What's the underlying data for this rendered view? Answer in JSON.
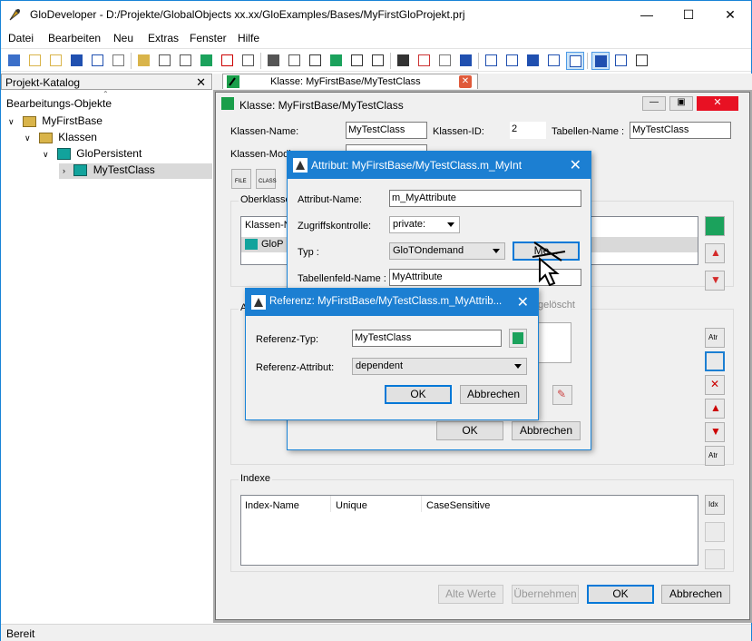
{
  "app": {
    "title": "GloDeveloper - D:/Projekte/GlobalObjects xx.xx/GloExamples/Bases/MyFirstGloProjekt.prj",
    "accent": "#1c7fd2"
  },
  "menu": [
    "Datei",
    "Bearbeiten",
    "Neu",
    "Extras",
    "Fenster",
    "Hilfe"
  ],
  "toolbar": {
    "icons": [
      "new-icon",
      "open-icon",
      "open-folder-icon",
      "save-icon",
      "save-all-icon",
      "properties-icon",
      "folder-icon",
      "new-file-icon",
      "new-class-icon",
      "edit-icon",
      "delete-icon",
      "cut-icon",
      "copy-icon",
      "paste-icon",
      "attribute-icon",
      "refresh-icon",
      "new-attribute-icon",
      "new-index-icon",
      "globe-icon",
      "grid-icon",
      "tools-icon",
      "window-icon",
      "cascade-icon",
      "tile-icon",
      "restore-icon",
      "maximize-icon",
      "layout-icon",
      "split-icon",
      "panel-icon",
      "book-icon"
    ]
  },
  "left_panel": {
    "header": "Projekt-Katalog",
    "section": "Bearbeitungs-Objekte",
    "tree": [
      {
        "label": "MyFirstBase",
        "level": 0
      },
      {
        "label": "Klassen",
        "level": 1
      },
      {
        "label": "GloPersistent",
        "level": 2
      },
      {
        "label": "MyTestClass",
        "level": 3,
        "selected": true
      }
    ]
  },
  "tab": {
    "label": "Klasse: MyFirstBase/MyTestClass"
  },
  "class_window": {
    "title": "Klasse: MyFirstBase/MyTestClass",
    "class_name_label": "Klassen-Name:",
    "class_name": "MyTestClass",
    "class_id_label": "Klassen-ID:",
    "class_id": "2",
    "table_name_label": "Tabellen-Name :",
    "table_name": "MyTestClass",
    "class_mod_label": "Klassen-Modi",
    "superclass_label": "Oberklasse",
    "superclass_col": "Klassen-N",
    "superclass_item": "GloP",
    "attributes_label": "A",
    "indexes_label": "Indexe",
    "index_cols": [
      "Index-Name",
      "Unique",
      "CaseSensitive"
    ],
    "buttons": {
      "old_values": "Alte Werte",
      "apply": "Übernehmen",
      "ok": "OK",
      "cancel": "Abbrechen"
    }
  },
  "attr_dialog": {
    "title": "Attribut: MyFirstBase/MyTestClass.m_MyInt",
    "name_label": "Attribut-Name:",
    "name": "m_MyAttribute",
    "access_label": "Zugriffskontrolle:",
    "access": "private:",
    "type_label": "Typ :",
    "type": "GloTOndemand",
    "more_button": "Me...",
    "field_label": "Tabellenfeld-Name :",
    "field": "MyAttribute",
    "deleted_label": "gelöscht",
    "ok": "OK",
    "cancel": "Abbrechen"
  },
  "ref_dialog": {
    "title": "Referenz: MyFirstBase/MyTestClass.m_MyAttrib...",
    "ref_type_label": "Referenz-Typ:",
    "ref_type": "MyTestClass",
    "ref_attr_label": "Referenz-Attribut:",
    "ref_attr": "dependent",
    "ok": "OK",
    "cancel": "Abbrechen"
  },
  "status": {
    "text": "Bereit"
  }
}
